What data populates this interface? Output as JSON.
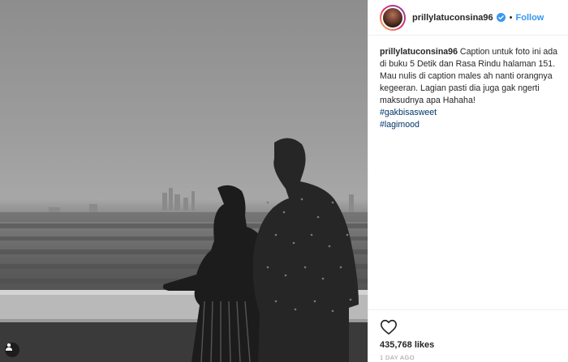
{
  "post": {
    "username": "prillylatuconsina96",
    "follow_label": "Follow",
    "dot": "•",
    "caption": {
      "username": "prillylatuconsina96",
      "text": "Caption untuk foto ini ada di buku 5 Detik dan Rasa Rindu halaman 151. Mau nulis di caption males ah nanti orangnya kegeeran. Lagian pasti dia juga gak ngerti maksudnya apa Hahaha!",
      "hashtags": [
        "#gakbisasweet",
        "#lagimood"
      ]
    },
    "likes": "435,768 likes",
    "timestamp": "1 DAY AGO"
  },
  "icons": {
    "verified": "verified-badge-icon",
    "heart": "heart-icon",
    "tagged_user": "tagged-user-icon"
  },
  "colors": {
    "follow": "#3897f0",
    "hashtag": "#003569",
    "verified": "#3897f0"
  }
}
